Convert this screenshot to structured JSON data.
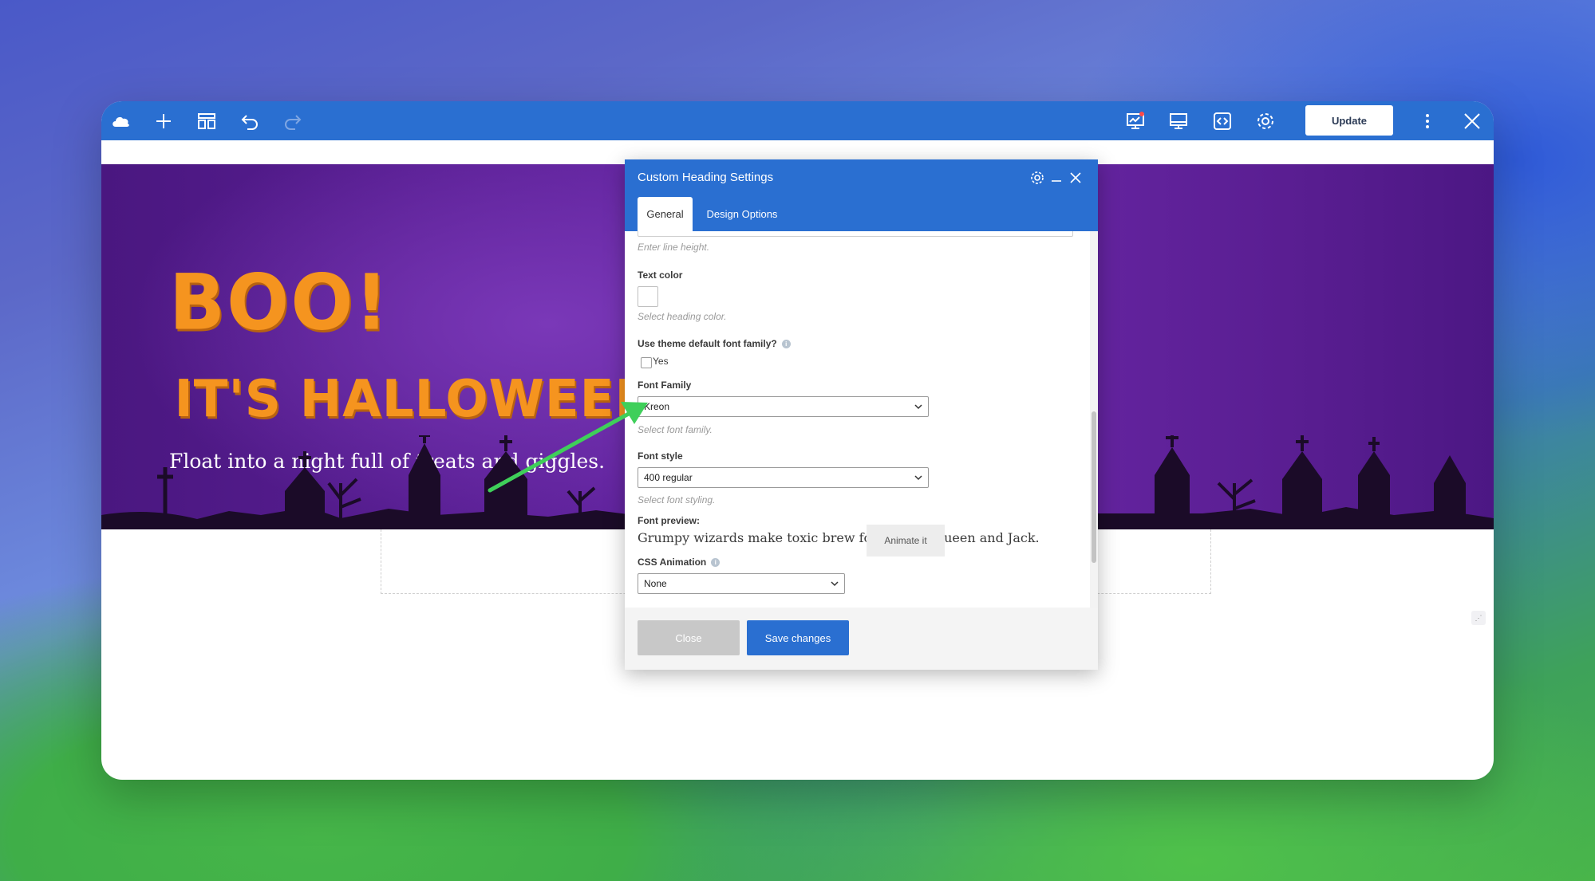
{
  "toolbar": {
    "icons": [
      "cloud-icon",
      "plus-icon",
      "layout-icon",
      "undo-icon",
      "redo-icon",
      "analytics-icon",
      "desktop-icon",
      "code-icon",
      "settings-icon",
      "more-vertical-icon",
      "close-icon"
    ],
    "update_label": "Update"
  },
  "banner": {
    "heading1": "BOO!",
    "heading2": "IT'S HALLOWEEN!",
    "tagline": "Float into a night full of treats and giggles.",
    "colors": {
      "heading": "#f5941f",
      "background": "#5e219a"
    }
  },
  "modal": {
    "title": "Custom Heading Settings",
    "tabs": [
      {
        "label": "General",
        "active": true
      },
      {
        "label": "Design Options",
        "active": false
      }
    ],
    "fields": {
      "line_height_help": "Enter line height.",
      "text_color_label": "Text color",
      "text_color_help": "Select heading color.",
      "theme_font_label": "Use theme default font family?",
      "theme_font_option": "Yes",
      "theme_font_checked": false,
      "font_family_label": "Font Family",
      "font_family_value": "Kreon",
      "font_family_help": "Select font family.",
      "font_style_label": "Font style",
      "font_style_value": "400 regular",
      "font_style_help": "Select font styling.",
      "font_preview_label": "Font preview:",
      "font_preview_text": "Grumpy wizards make toxic brew for the evil Queen and Jack.",
      "css_animation_label": "CSS Animation",
      "css_animation_value": "None",
      "animate_button": "Animate it"
    },
    "footer": {
      "close_label": "Close",
      "save_label": "Save changes"
    }
  },
  "colors": {
    "toolbar": "#2a6fd1",
    "annotation_arrow": "#3fcf5a"
  }
}
